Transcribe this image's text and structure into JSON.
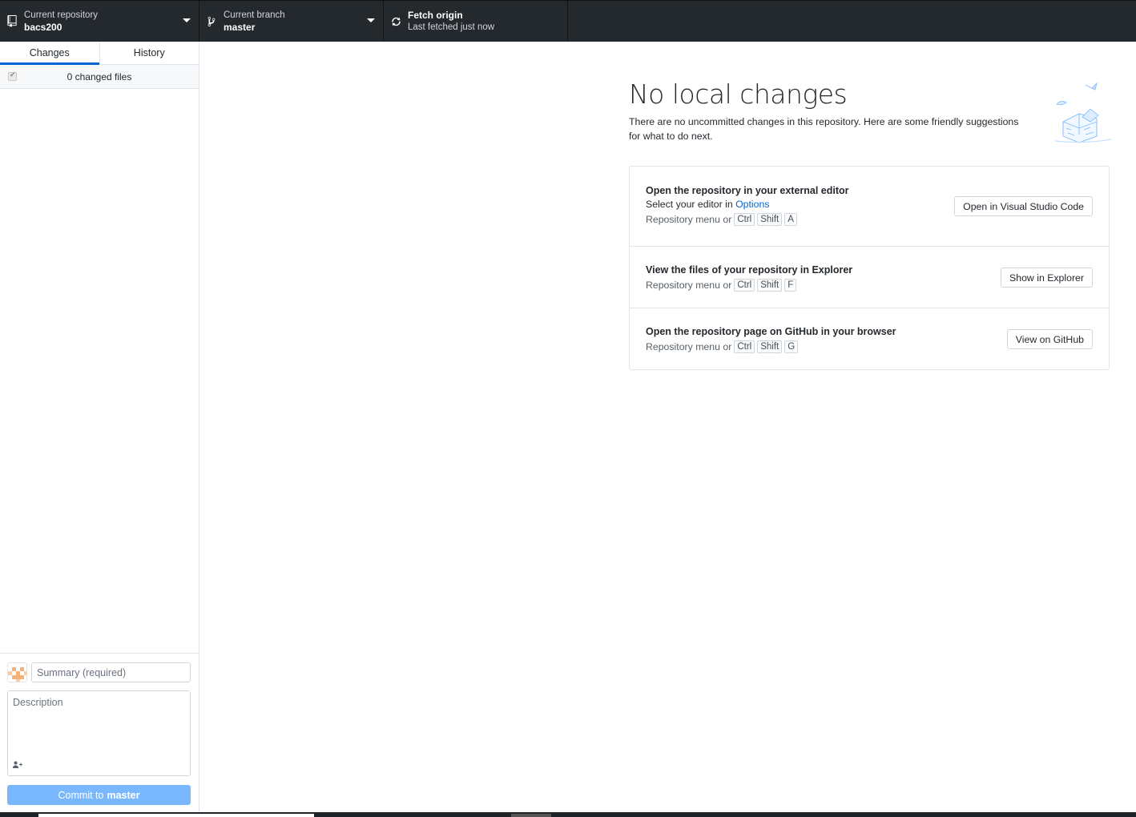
{
  "toolbar": {
    "repo": {
      "label": "Current repository",
      "value": "bacs200",
      "icon": "repo-icon"
    },
    "branch": {
      "label": "Current branch",
      "value": "master",
      "icon": "git-branch-icon"
    },
    "fetch": {
      "label": "Fetch origin",
      "value": "Last fetched just now",
      "icon": "sync-icon"
    }
  },
  "sidebar": {
    "tabs": [
      {
        "label": "Changes",
        "selected": true
      },
      {
        "label": "History",
        "selected": false
      }
    ],
    "changed_files": "0 changed files",
    "commit": {
      "summary_placeholder": "Summary (required)",
      "description_placeholder": "Description",
      "button_prefix": "Commit to",
      "button_branch": "master"
    }
  },
  "main": {
    "heading": "No local changes",
    "subtext": "There are no uncommitted changes in this repository. Here are some friendly suggestions for what to do next.",
    "suggestions": [
      {
        "title": "Open the repository in your external editor",
        "sub_prefix": "Select your editor in",
        "sub_link": "Options",
        "shortcut_prefix": "Repository menu or",
        "keys": [
          "Ctrl",
          "Shift",
          "A"
        ],
        "button": "Open in Visual Studio Code"
      },
      {
        "title": "View the files of your repository in Explorer",
        "shortcut_prefix": "Repository menu or",
        "keys": [
          "Ctrl",
          "Shift",
          "F"
        ],
        "button": "Show in Explorer"
      },
      {
        "title": "Open the repository page on GitHub in your browser",
        "shortcut_prefix": "Repository menu or",
        "keys": [
          "Ctrl",
          "Shift",
          "G"
        ],
        "button": "View on GitHub"
      }
    ]
  },
  "colors": {
    "toolbar_bg": "#24292e",
    "accent": "#0366d6",
    "commit_button": "#79b8ff"
  }
}
